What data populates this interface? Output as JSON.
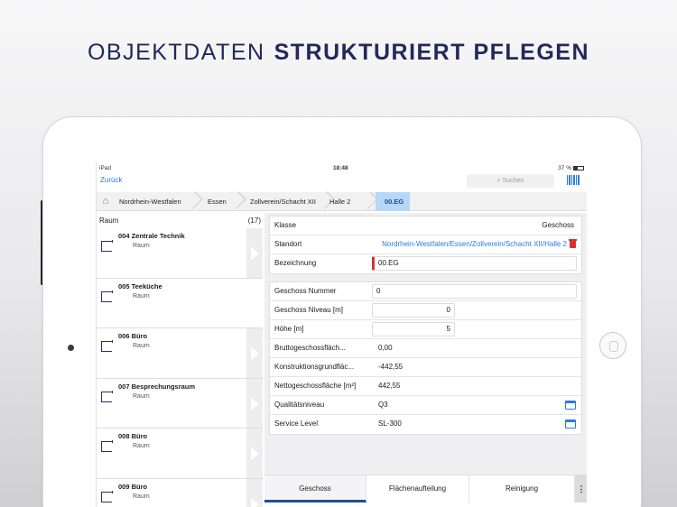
{
  "headline": {
    "light": "OBJEKTDATEN",
    "bold": "STRUKTURIERT PFLEGEN"
  },
  "status_bar": {
    "device": "iPad",
    "time": "18:48",
    "battery": "37 %"
  },
  "nav": {
    "back_label": "Zurück",
    "search_placeholder": "Suchen"
  },
  "breadcrumbs": [
    "Nordrhein-Westfalen",
    "Essen",
    "Zollverein/Schacht XII",
    "Halle 2",
    "00.EG"
  ],
  "room_list": {
    "title": "Raum",
    "count": "(17)",
    "items": [
      {
        "name": "004 Zentrale Technik",
        "type": "Raum"
      },
      {
        "name": "005 Teeküche",
        "type": "Raum"
      },
      {
        "name": "006 Büro",
        "type": "Raum"
      },
      {
        "name": "007 Besprechungsraum",
        "type": "Raum"
      },
      {
        "name": "008 Büro",
        "type": "Raum"
      },
      {
        "name": "009 Büro",
        "type": "Raum"
      }
    ]
  },
  "detail": {
    "klasse": {
      "label": "Klasse",
      "value": "Geschoss"
    },
    "standort": {
      "label": "Standort",
      "value": "Nordrhein-Westfalen/Essen/Zollverein/Schacht XII/Halle 2"
    },
    "bezeichnung": {
      "label": "Bezeichnung",
      "value": "00.EG"
    },
    "geschoss_nummer": {
      "label": "Geschoss Nummer",
      "value": "0"
    },
    "geschoss_niveau": {
      "label": "Geschoss Niveau [m]",
      "value": "0"
    },
    "hoehe": {
      "label": "Höhe [m]",
      "value": "5"
    },
    "brutto": {
      "label": "Bruttogeschossfläch...",
      "value": "0,00"
    },
    "konstruktion": {
      "label": "Konstruktionsgrundfläc...",
      "value": "-442,55"
    },
    "netto": {
      "label": "Nettogeschossfläche [m²]",
      "value": "442,55"
    },
    "qualitaet": {
      "label": "Qualitätsniveau",
      "value": "Q3"
    },
    "service": {
      "label": "Service Level",
      "value": "SL-300"
    }
  },
  "tabs": [
    "Geschoss",
    "Flächenaufteilung",
    "Reinigung"
  ],
  "colors": {
    "accent": "#2a7ae2",
    "active_crumb": "#b7d7f6",
    "delete": "#d63232",
    "headline": "#22295a"
  }
}
